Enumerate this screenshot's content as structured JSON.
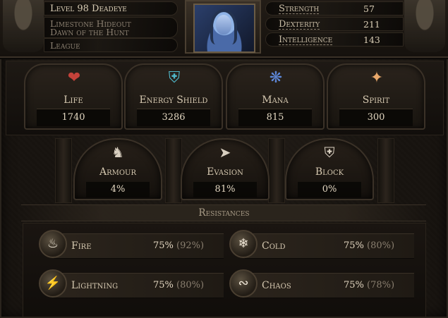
{
  "character": {
    "level_class": "Level 98 Deadeye",
    "area": "Limestone Hideout",
    "league_line1": "Dawn of the Hunt",
    "league_line2": "League"
  },
  "attributes": [
    {
      "name": "Strength",
      "value": "57"
    },
    {
      "name": "Dexterity",
      "value": "211"
    },
    {
      "name": "Intelligence",
      "value": "143"
    }
  ],
  "main_stats": [
    {
      "label": "Life",
      "value": "1740",
      "icon": "heart-icon",
      "color": "#c4423a"
    },
    {
      "label": "Energy Shield",
      "value": "3286",
      "icon": "energy-shield-icon",
      "color": "#4fb6c8"
    },
    {
      "label": "Mana",
      "value": "815",
      "icon": "mana-icon",
      "color": "#5d86d6"
    },
    {
      "label": "Spirit",
      "value": "300",
      "icon": "spirit-icon",
      "color": "#e8a76a"
    }
  ],
  "defences": [
    {
      "label": "Armour",
      "value": "4%",
      "icon": "armour-icon"
    },
    {
      "label": "Evasion",
      "value": "81%",
      "icon": "evasion-icon"
    },
    {
      "label": "Block",
      "value": "0%",
      "icon": "block-icon"
    }
  ],
  "resistances": {
    "title": "Resistances",
    "items": [
      {
        "name": "Fire",
        "value": "75%",
        "max": "(92%)",
        "icon": "fire-icon"
      },
      {
        "name": "Cold",
        "value": "75%",
        "max": "(80%)",
        "icon": "cold-icon"
      },
      {
        "name": "Lightning",
        "value": "75%",
        "max": "(80%)",
        "icon": "lightning-icon"
      },
      {
        "name": "Chaos",
        "value": "75%",
        "max": "(78%)",
        "icon": "chaos-icon"
      }
    ]
  }
}
